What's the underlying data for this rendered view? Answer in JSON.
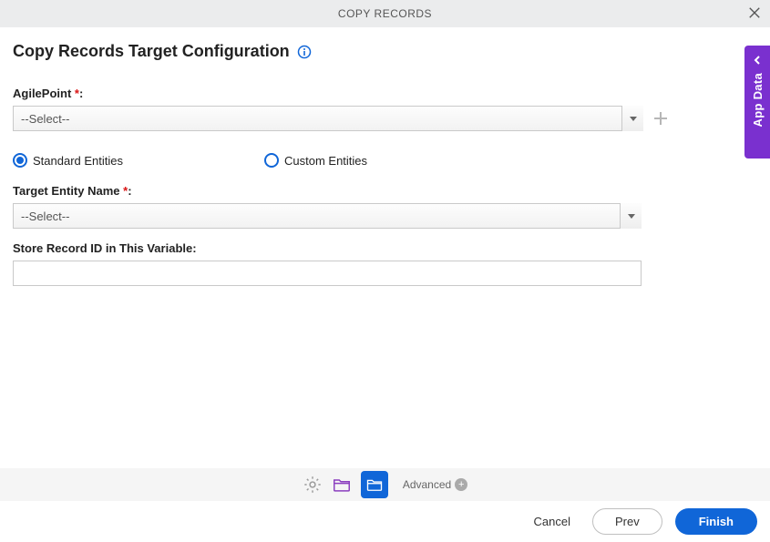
{
  "header": {
    "title": "COPY RECORDS"
  },
  "page": {
    "title": "Copy Records Target Configuration"
  },
  "form": {
    "agilepoint": {
      "label": "AgilePoint",
      "selected": "--Select--"
    },
    "entity_type": {
      "standard": {
        "label": "Standard Entities",
        "selected": true
      },
      "custom": {
        "label": "Custom Entities",
        "selected": false
      }
    },
    "target_entity": {
      "label": "Target Entity Name",
      "selected": "--Select--"
    },
    "store_record": {
      "label": "Store Record ID in This Variable:",
      "value": ""
    }
  },
  "toolbar": {
    "advanced_label": "Advanced"
  },
  "footer": {
    "cancel_label": "Cancel",
    "prev_label": "Prev",
    "finish_label": "Finish"
  },
  "side_tab": {
    "label": "App Data"
  }
}
